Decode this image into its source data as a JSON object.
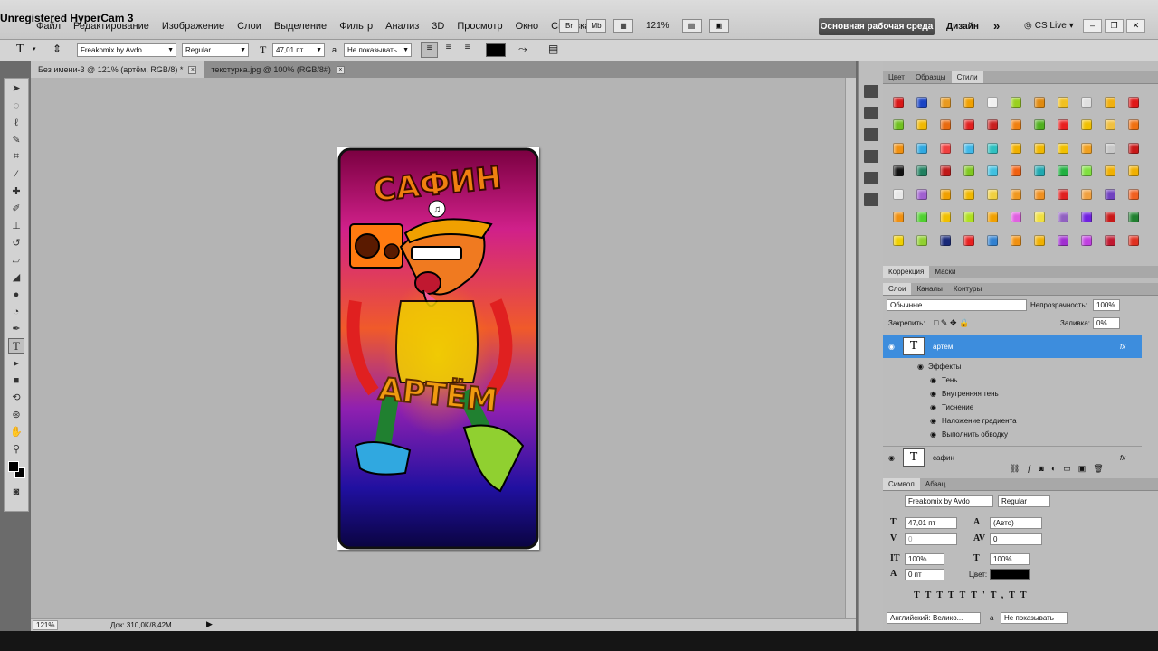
{
  "watermark": "Unregistered HyperCam 3",
  "menu": [
    "Файл",
    "Редактирование",
    "Изображение",
    "Слои",
    "Выделение",
    "Фильтр",
    "Анализ",
    "3D",
    "Просмотр",
    "Окно",
    "Справка"
  ],
  "menu_zoom": "121%",
  "workspace_button": "Основная рабочая среда",
  "design_label": "Дизайн",
  "cs_live": "CS Live",
  "options": {
    "tool_icon": "T",
    "font_family": "Freakomix by Avdo",
    "font_style": "Regular",
    "font_size": "47,01 пт",
    "aa_label": "а",
    "aa_value": "Не показывать"
  },
  "tabs": [
    {
      "label": "Без имени-3 @ 121% (артём, RGB/8) *"
    },
    {
      "label": "текстурка.jpg @ 100% (RGB/8#)"
    }
  ],
  "status": {
    "zoom": "121%",
    "doc": "Док: 310,0K/8,42M"
  },
  "canvas_text": {
    "top": "САФИН",
    "bottom": "АРТЁМ"
  },
  "styles_panel": {
    "tabs": [
      "Цвет",
      "Образцы",
      "Стили"
    ],
    "colors": [
      "#d81818",
      "#1a44c4",
      "#e89a20",
      "#f0a000",
      "#f0f0f0",
      "#9ad020",
      "#e08a10",
      "#f0c020",
      "#e0e0e0",
      "#f0b010",
      "#e01818",
      "#70c020",
      "#f0b800",
      "#e86a10",
      "#e02020",
      "#c82020",
      "#f08010",
      "#50b020",
      "#e82020",
      "#f0c000",
      "#f0c040",
      "#f07010",
      "#f09010",
      "#30a8e0",
      "#f04040",
      "#40b8e8",
      "#30c0c0",
      "#f0b000",
      "#f0b800",
      "#f0c000",
      "#f0a020",
      "#c8c8c8",
      "#c81818",
      "#111111",
      "#208060",
      "#c01818",
      "#80c820",
      "#40c0e0",
      "#f06010",
      "#20a8b0",
      "#20b040",
      "#80e040",
      "#f0b000",
      "#f0b000",
      "#e8e8e8",
      "#a060d0",
      "#f0a000",
      "#f0b800",
      "#f0d040",
      "#f09820",
      "#f09020",
      "#e02020",
      "#f0a040",
      "#7040c0",
      "#f06020",
      "#f09010",
      "#50d030",
      "#f0c000",
      "#b0e020",
      "#f0a000",
      "#e060e0",
      "#f0e040",
      "#9060c0",
      "#7020e0",
      "#c81818",
      "#208030",
      "#f0d000",
      "#90d030",
      "#182878",
      "#e82020",
      "#3080d0",
      "#f09010",
      "#f0b000",
      "#a030d0",
      "#c040e0",
      "#c01830",
      "#e03020"
    ]
  },
  "adjust_tabs": [
    "Коррекция",
    "Маски"
  ],
  "layers_panel": {
    "tabs": [
      "Слои",
      "Каналы",
      "Контуры"
    ],
    "blend_mode": "Обычные",
    "opacity_label": "Непрозрачность:",
    "opacity_value": "100%",
    "lock_label": "Закрепить:",
    "fill_label": "Заливка:",
    "fill_value": "0%",
    "layer1": "артём",
    "effects_label": "Эффекты",
    "effects": [
      "Тень",
      "Внутренняя тень",
      "Тиснение",
      "Наложение градиента",
      "Выполнить обводку"
    ],
    "layer2": "сафин",
    "fx": "fx"
  },
  "char_panel": {
    "tabs": [
      "Символ",
      "Абзац"
    ],
    "font_family": "Freakomix by Avdo",
    "font_style": "Regular",
    "size": "47,01 пт",
    "leading": "(Авто)",
    "kerning": "0",
    "tracking": "0",
    "vscale": "100%",
    "hscale": "100%",
    "baseline": "0 пт",
    "color_label": "Цвет:",
    "language": "Английский: Велико...",
    "aa_value": "Не показывать"
  }
}
